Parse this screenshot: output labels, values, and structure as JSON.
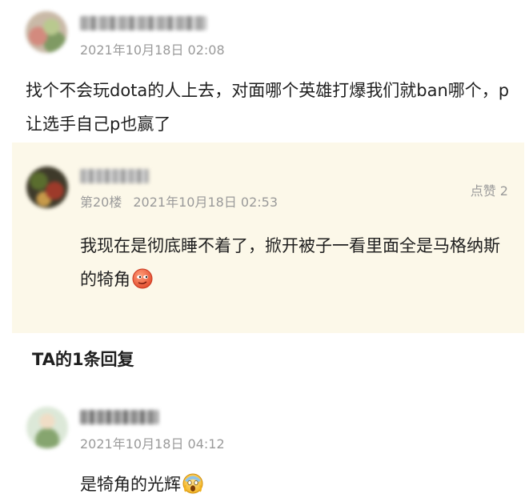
{
  "top_comment": {
    "timestamp": "2021年10月18日 02:08",
    "text": "找个不会玩dota的人上去，对面哪个英雄打爆我们就ban哪个，p让选手自己p也赢了"
  },
  "reply": {
    "floor": "第20楼",
    "timestamp": "2021年10月18日 02:53",
    "like_label": "点赞 2",
    "text": "我现在是彻底睡不着了，掀开被子一看里面全是马格纳斯的犄角",
    "emoji": "smirk-face-icon"
  },
  "replies_header": "TA的1条回复",
  "sub_reply": {
    "timestamp": "2021年10月18日 04:12",
    "text": "是犄角的光辉",
    "emoji": "screaming-face-icon"
  }
}
